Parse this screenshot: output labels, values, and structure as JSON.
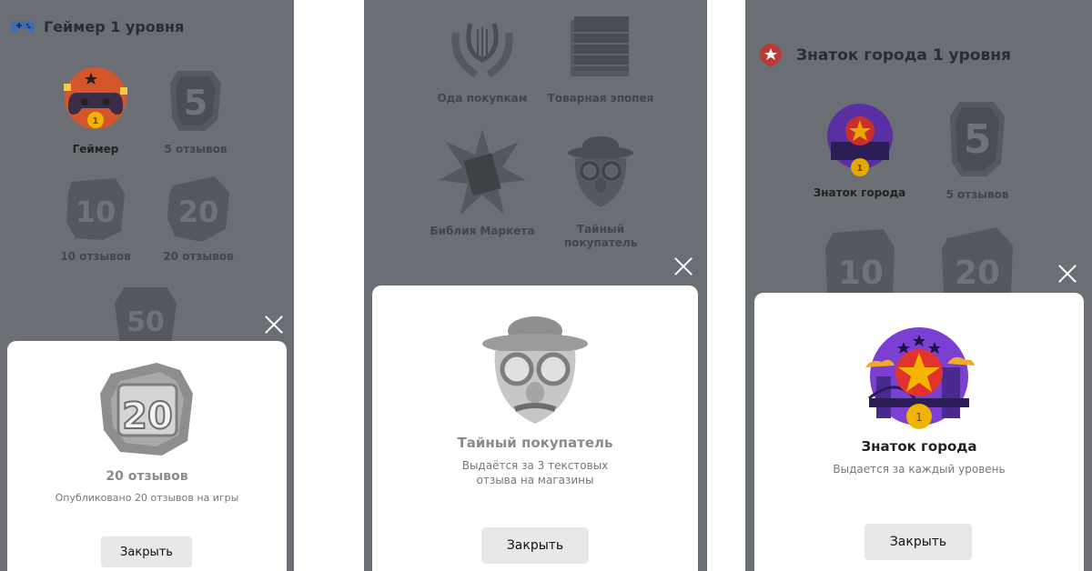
{
  "screen1": {
    "header_title": "Геймер 1 уровня",
    "badges": [
      {
        "label": "Геймер",
        "number": "",
        "medal": "1"
      },
      {
        "label": "5 отзывов",
        "number": "5"
      },
      {
        "label": "10 отзывов",
        "number": "10"
      },
      {
        "label": "20 отзывов",
        "number": "20"
      },
      {
        "label": "",
        "number": "50"
      }
    ],
    "sheet": {
      "badge_number": "20",
      "title": "20 отзывов",
      "description": "Опубликовано 20 отзывов на игры",
      "close_label": "Закрыть"
    }
  },
  "screen2": {
    "badges": [
      {
        "label": "Ода покупкам"
      },
      {
        "label": "Товарная эпопея"
      },
      {
        "label": "Библия Маркета"
      },
      {
        "label": "Тайный покупатель"
      }
    ],
    "sheet": {
      "title": "Тайный покупатель",
      "description": "Выдаётся за 3 текстовых отзыва на магазины",
      "close_label": "Закрыть"
    }
  },
  "screen3": {
    "header_title": "Знаток города 1 уровня",
    "badges": [
      {
        "label": "Знаток города",
        "medal": "1"
      },
      {
        "label": "5 отзывов",
        "number": "5"
      },
      {
        "label": "",
        "number": "10"
      },
      {
        "label": "",
        "number": "20"
      }
    ],
    "sheet": {
      "medal": "1",
      "title": "Знаток города",
      "description": "Выдается за каждый уровень",
      "close_label": "Закрыть"
    }
  },
  "colors": {
    "overlay": "#6b6e74",
    "sheet_bg": "#ffffff",
    "button_bg": "#e8e8e8",
    "gamer_orange": "#d4562a",
    "city_purple": "#7b3fd1",
    "star_red": "#e2322e",
    "medal_gold": "#f0b400"
  }
}
